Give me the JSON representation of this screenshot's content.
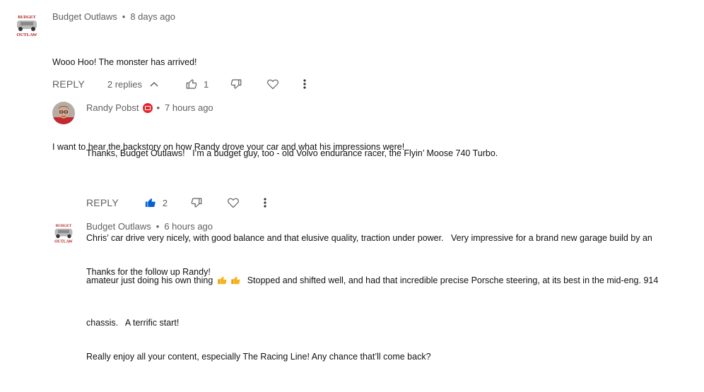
{
  "comments": [
    {
      "author": "Budget Outlaws",
      "time": "8 days ago",
      "lines": [
        "Wooo Hoo! The monster has arrived!",
        "",
        "I want to hear the backstory on how Randy drove your car and what his impressions were!"
      ],
      "reply_label": "REPLY",
      "replies_label": "2 replies",
      "like_count": "1"
    },
    {
      "author": "Randy Pobst",
      "time": "7 hours ago",
      "line1": "Thanks, Budget Outlaws!   I’m a budget guy, too - old Volvo endurance racer, the Flyin’ Moose 740 Turbo.",
      "line3": "Chris’ car drive very nicely, with good balance and that elusive quality, traction under power.   Very impressive for a brand new garage build by an",
      "line4_a": "amateur just doing his own thing ",
      "line4_b": "  Stopped and shifted well, and had that incredible precise Porsche steering, at its best in the mid-eng. 914",
      "line5": "chassis.   A terrific start!",
      "reply_label": "REPLY",
      "like_count": "2"
    },
    {
      "author": "Budget Outlaws",
      "time": "6 hours ago",
      "lines": [
        "Thanks for the follow up Randy!",
        "",
        "Really enjoy all your content, especially The Racing Line! Any chance that’ll come back?"
      ]
    }
  ],
  "logo_text": {
    "top": "BUDGET",
    "bottom": "OUTLAW"
  },
  "dot": "•",
  "colors": {
    "meta": "#606060",
    "liked": "#065fd4",
    "badge": "#e0262b"
  }
}
